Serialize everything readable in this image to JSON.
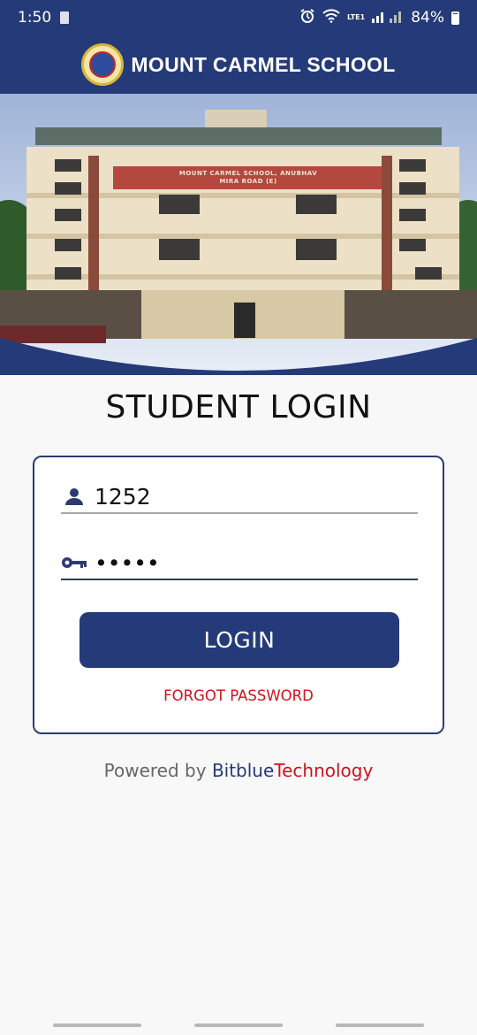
{
  "status": {
    "time": "1:50",
    "network_label": "LTE1",
    "battery": "84%",
    "battery_level": 0.84,
    "icons": [
      "sim-icon",
      "alarm-icon",
      "wifi-icon",
      "signal-icon",
      "battery-icon"
    ]
  },
  "app": {
    "title": "MOUNT CARMEL SCHOOL",
    "banner_sign": [
      "MOUNT CARMEL SCHOOL, ANUBHAV",
      "MIRA ROAD (E)"
    ]
  },
  "login": {
    "heading": "STUDENT LOGIN",
    "user_id": "1252",
    "password_masked": "•••••",
    "button_label": "LOGIN",
    "forgot_label": "FORGOT PASSWORD"
  },
  "footer": {
    "powered_prefix": "Powered by ",
    "brand_part1": "Bitblue",
    "brand_part2": "Technology"
  },
  "colors": {
    "primary": "#253a78",
    "accent_red": "#d0121a"
  }
}
